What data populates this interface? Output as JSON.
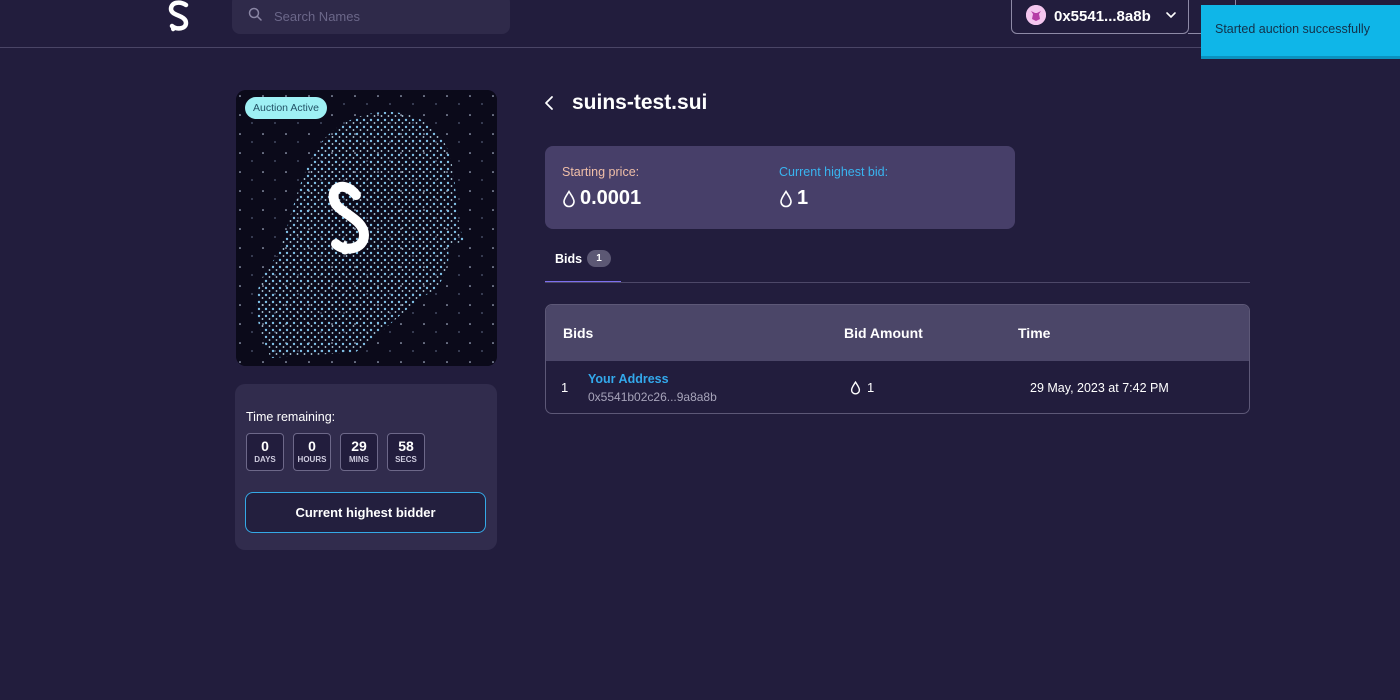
{
  "header": {
    "search_placeholder": "Search Names",
    "wallet_address": "0x5541...8a8b"
  },
  "toast": {
    "message": "Started auction successfully"
  },
  "nft": {
    "badge": "Auction Active"
  },
  "timer": {
    "label": "Time remaining:",
    "units": [
      {
        "value": "0",
        "label": "DAYS"
      },
      {
        "value": "0",
        "label": "HOURS"
      },
      {
        "value": "29",
        "label": "MINS"
      },
      {
        "value": "58",
        "label": "SECS"
      }
    ],
    "button_label": "Current highest bidder"
  },
  "domain": {
    "title": "suins-test.sui"
  },
  "prices": {
    "starting_label": "Starting price:",
    "starting_value": "0.0001",
    "starting_color": "#f0bfa8",
    "highest_label": "Current highest bid:",
    "highest_value": "1",
    "highest_color": "#39b4f0"
  },
  "tabs": [
    {
      "label": "Bids",
      "count": "1"
    }
  ],
  "table": {
    "columns": [
      "Bids",
      "Bid Amount",
      "Time"
    ],
    "rows": [
      {
        "index": "1",
        "name": "Your Address",
        "address": "0x5541b02c26...9a8a8b",
        "amount": "1",
        "time": "29 May, 2023 at 7:42 PM"
      }
    ]
  },
  "colors": {
    "background": "#221d3d",
    "accent": "#34a9e6",
    "tab_underline": "#7d6ff0",
    "toast": "#0fb6e8"
  }
}
